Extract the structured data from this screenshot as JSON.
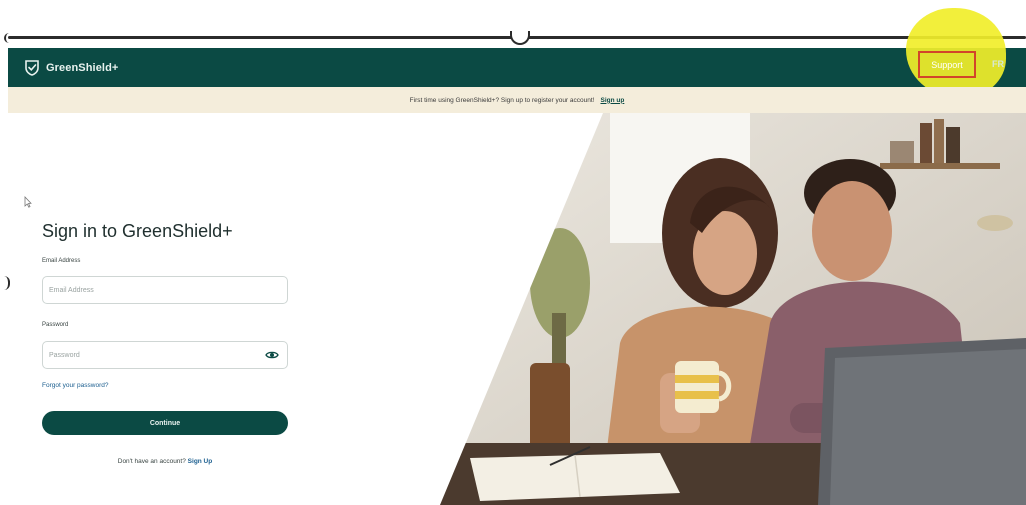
{
  "navbar": {
    "brand": "GreenShield+",
    "support_label": "Support",
    "language_label": "FR"
  },
  "banner": {
    "message": "First time using GreenShield+? Sign up to register your account!",
    "link_label": "Sign up"
  },
  "form": {
    "title": "Sign in to GreenShield+",
    "email_label": "Email Address",
    "email_placeholder": "Email Address",
    "password_label": "Password",
    "password_placeholder": "Password",
    "forgot_label": "Forgot your password?",
    "continue_label": "Continue",
    "signup_prompt": "Don't have an account?",
    "signup_label": "Sign Up"
  },
  "colors": {
    "brand_green": "#0b4a44",
    "banner_cream": "#f4eddb",
    "link_blue": "#1b5e8f",
    "highlight_yellow": "#f1ee2a",
    "highlight_box": "#d2452a"
  },
  "icons": {
    "logo": "shield-check-icon",
    "password_toggle": "eye-icon"
  }
}
